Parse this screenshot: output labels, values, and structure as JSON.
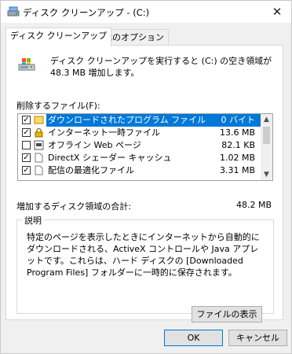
{
  "window": {
    "title": "ディスク クリーンアップ - (C:)",
    "close_symbol": "✕"
  },
  "tabs": [
    {
      "label": "ディスク クリーンアップ",
      "active": true
    },
    {
      "label": "その他のオプション",
      "active": false
    }
  ],
  "intro_text": "ディスク クリーンアップを実行すると (C:) の空き領域が 48.3 MB 増加します。",
  "files_label": "削除するファイル(F):",
  "files": [
    {
      "name": "ダウンロードされたプログラム ファイル",
      "size": "0 バイト",
      "checked": true,
      "selected": true,
      "icon": "folder-icon"
    },
    {
      "name": "インターネット一時ファイル",
      "size": "13.6 MB",
      "checked": true,
      "selected": false,
      "icon": "lock-icon"
    },
    {
      "name": "オフライン Web ページ",
      "size": "82.1 KB",
      "checked": false,
      "selected": false,
      "icon": "offline-page-icon"
    },
    {
      "name": "DirectX シェーダー キャッシュ",
      "size": "1.02 MB",
      "checked": true,
      "selected": false,
      "icon": "file-icon"
    },
    {
      "name": "配信の最適化ファイル",
      "size": "3.31 MB",
      "checked": true,
      "selected": false,
      "icon": "file-icon"
    }
  ],
  "space_gain_label": "増加するディスク領域の合計:",
  "space_gain_value": "48.2 MB",
  "description": {
    "legend": "説明",
    "text": "特定のページを表示したときにインターネットから自動的にダウンロードされる、ActiveX コントロールや Java アプレットです。これらは、ハード ディスクの [Downloaded Program Files] フォルダーに一時的に保存されます。"
  },
  "buttons": {
    "view_files": "ファイルの表示(V)",
    "ok": "OK",
    "cancel": "キャンセル"
  },
  "colors": {
    "selection": "#0078d7",
    "dialog_bg": "#f0f0f0"
  }
}
